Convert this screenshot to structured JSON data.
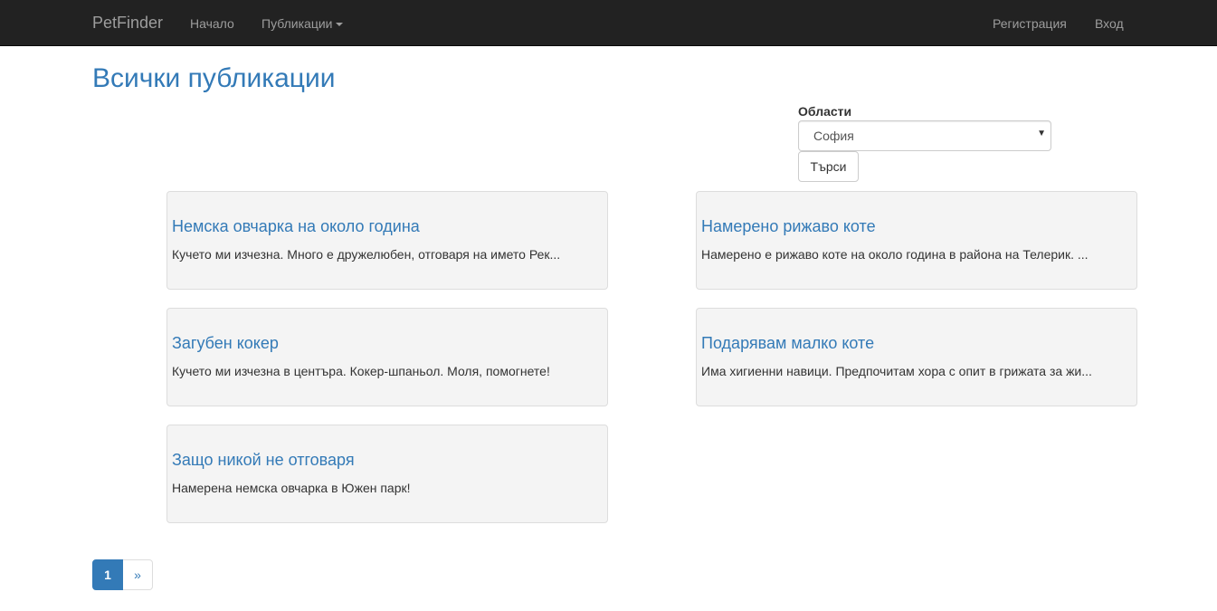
{
  "navbar": {
    "brand": "PetFinder",
    "home": "Начало",
    "publications": "Публикации",
    "register": "Регистрация",
    "login": "Вход"
  },
  "page": {
    "title": "Всички публикации"
  },
  "filter": {
    "label": "Области",
    "selected": "София",
    "search_label": "Търси"
  },
  "posts": [
    {
      "title": "Немска овчарка на около година",
      "text": "Кучето ми изчезна. Много е дружелюбен, отговаря на името Рек..."
    },
    {
      "title": "Намерено рижаво коте",
      "text": "Намерено е рижаво коте на около година в района на Телерик. ..."
    },
    {
      "title": "Загубен кокер",
      "text": "Кучето ми изчезна в центъра. Кокер-шпаньол. Моля, помогнете!"
    },
    {
      "title": "Подарявам малко коте",
      "text": "Има хигиенни навици. Предпочитам хора с опит в грижата за жи..."
    },
    {
      "title": "Защо никой не отговаря",
      "text": "Намерена немска овчарка в Южен парк!"
    }
  ],
  "pagination": {
    "current": "1",
    "next": "»"
  },
  "colors": {
    "navbar_bg": "#222222",
    "link": "#337ab7",
    "card_bg": "#f4f4f4"
  }
}
